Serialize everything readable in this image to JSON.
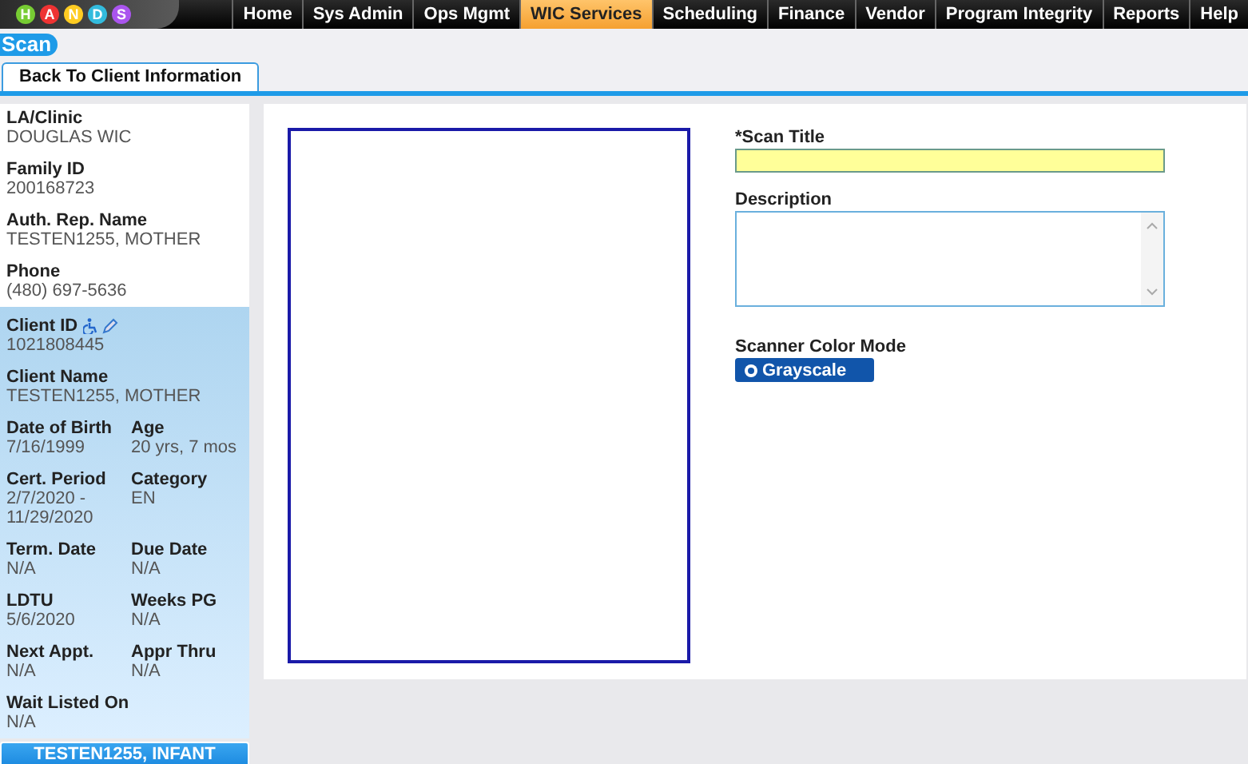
{
  "logo": {
    "letters": [
      "H",
      "A",
      "N",
      "D",
      "S"
    ]
  },
  "nav": [
    {
      "label": "Home",
      "selected": false
    },
    {
      "label": "Sys Admin",
      "selected": false
    },
    {
      "label": "Ops Mgmt",
      "selected": false
    },
    {
      "label": "WIC Services",
      "selected": true
    },
    {
      "label": "Scheduling",
      "selected": false
    },
    {
      "label": "Finance",
      "selected": false
    },
    {
      "label": "Vendor",
      "selected": false
    },
    {
      "label": "Program Integrity",
      "selected": false
    },
    {
      "label": "Reports",
      "selected": false
    },
    {
      "label": "Help",
      "selected": false
    }
  ],
  "page_title": "Scan",
  "back_tab": "Back To Client Information",
  "sidebar": {
    "top_fields": [
      {
        "label": "LA/Clinic",
        "value": "DOUGLAS WIC"
      },
      {
        "label": "Family ID",
        "value": "200168723"
      },
      {
        "label": "Auth. Rep. Name",
        "value": "TESTEN1255, MOTHER"
      },
      {
        "label": "Phone",
        "value": "(480) 697-5636"
      }
    ],
    "client_id": {
      "label": "Client ID",
      "value": "1021808445"
    },
    "client_name": {
      "label": "Client Name",
      "value": "TESTEN1255, MOTHER"
    },
    "pairs": [
      [
        {
          "label": "Date of Birth",
          "value": "7/16/1999"
        },
        {
          "label": "Age",
          "value": "20 yrs, 7 mos"
        }
      ],
      [
        {
          "label": "Cert. Period",
          "value": "2/7/2020 - 11/29/2020"
        },
        {
          "label": "Category",
          "value": "EN"
        }
      ],
      [
        {
          "label": "Term. Date",
          "value": "N/A"
        },
        {
          "label": "Due Date",
          "value": "N/A"
        }
      ],
      [
        {
          "label": "LDTU",
          "value": "5/6/2020"
        },
        {
          "label": "Weeks PG",
          "value": "N/A"
        }
      ],
      [
        {
          "label": "Next Appt.",
          "value": "N/A"
        },
        {
          "label": "Appr Thru",
          "value": "N/A"
        }
      ]
    ],
    "wait_listed": {
      "label": "Wait Listed On",
      "value": "N/A"
    },
    "linked_client": "TESTEN1255, INFANT"
  },
  "form": {
    "scan_title_label": "*Scan Title",
    "description_label": "Description",
    "color_mode_label": "Scanner Color Mode",
    "color_modes": [
      {
        "label": "Grayscale",
        "selected": true
      }
    ]
  }
}
